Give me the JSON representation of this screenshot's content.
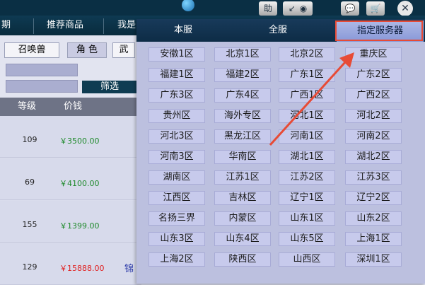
{
  "nav": {
    "items": [
      "期",
      "推荐商品",
      "我是"
    ]
  },
  "toolbar": {
    "help_label": "助",
    "close_label": "✕"
  },
  "filter": {
    "chips": [
      "召唤兽",
      "角 色",
      "武"
    ],
    "filter_button": "筛选"
  },
  "table": {
    "headers": [
      "等级",
      "价钱"
    ],
    "rows": [
      {
        "level": "109",
        "price": "￥3500.00",
        "price_color": "#1f8a2c",
        "extra": ""
      },
      {
        "level": "69",
        "price": "￥4100.00",
        "price_color": "#1f8a2c",
        "extra": ""
      },
      {
        "level": "155",
        "price": "￥1399.00",
        "price_color": "#1f8a2c",
        "extra": ""
      },
      {
        "level": "129",
        "price": "￥15888.00",
        "price_color": "#e02020",
        "extra": "锦"
      }
    ]
  },
  "popup": {
    "tabs": [
      "本服",
      "全服",
      "指定服务器"
    ],
    "active_tab": 2,
    "servers": [
      [
        "安徽1区",
        "北京1区",
        "北京2区",
        "重庆区"
      ],
      [
        "福建1区",
        "福建2区",
        "广东1区",
        "广东2区"
      ],
      [
        "广东3区",
        "广东4区",
        "广西1区",
        "广西2区"
      ],
      [
        "贵州区",
        "海外专区",
        "河北1区",
        "河北2区"
      ],
      [
        "河北3区",
        "黑龙江区",
        "河南1区",
        "河南2区"
      ],
      [
        "河南3区",
        "华南区",
        "湖北1区",
        "湖北2区"
      ],
      [
        "湖南区",
        "江苏1区",
        "江苏2区",
        "江苏3区"
      ],
      [
        "江西区",
        "吉林区",
        "辽宁1区",
        "辽宁2区"
      ],
      [
        "名扬三界",
        "内蒙区",
        "山东1区",
        "山东2区"
      ],
      [
        "山东3区",
        "山东4区",
        "山东5区",
        "上海1区"
      ],
      [
        "上海2区",
        "陕西区",
        "山西区",
        "深圳1区"
      ]
    ]
  },
  "colors": {
    "annotation": "#e74b36",
    "active_tab": "#8898d8"
  }
}
